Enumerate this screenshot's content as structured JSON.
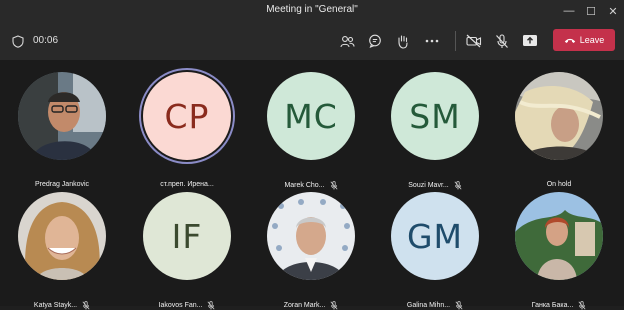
{
  "window": {
    "title": "Meeting in \"General\"",
    "minimize": "—",
    "maximize": "☐",
    "close": "✕"
  },
  "toolbar": {
    "timer": "00:06",
    "leave_label": "Leave"
  },
  "colors": {
    "leave": "#c4314b",
    "active_ring": "#8b8cc7"
  },
  "participants": [
    {
      "name": "Predrag Jankovic",
      "initials": "",
      "muted": false,
      "photo": true
    },
    {
      "name": "ст.преп. Ирена...",
      "initials": "CP",
      "muted": false,
      "photo": false,
      "bg": "#fbd9d3",
      "fg": "#8a2b1d",
      "active": true
    },
    {
      "name": "Marek Cho...",
      "initials": "MC",
      "muted": true,
      "photo": false,
      "bg": "#cfe8d8",
      "fg": "#255a3a"
    },
    {
      "name": "Souzi Mavr...",
      "initials": "SM",
      "muted": true,
      "photo": false,
      "bg": "#cfe8d8",
      "fg": "#255a3a"
    },
    {
      "name": "On hold",
      "initials": "",
      "muted": false,
      "photo": true
    },
    {
      "name": "Katya Stayk...",
      "initials": "",
      "muted": true,
      "photo": true
    },
    {
      "name": "Iakovos Fan...",
      "initials": "IF",
      "muted": true,
      "photo": false,
      "bg": "#dfe7d6",
      "fg": "#3b4a2f"
    },
    {
      "name": "Zoran Mark...",
      "initials": "",
      "muted": true,
      "photo": true
    },
    {
      "name": "Galina Mihn...",
      "initials": "GM",
      "muted": true,
      "photo": false,
      "bg": "#cfe1ee",
      "fg": "#1f4c6b"
    },
    {
      "name": "Ганка Бака...",
      "initials": "",
      "muted": true,
      "photo": true
    }
  ]
}
